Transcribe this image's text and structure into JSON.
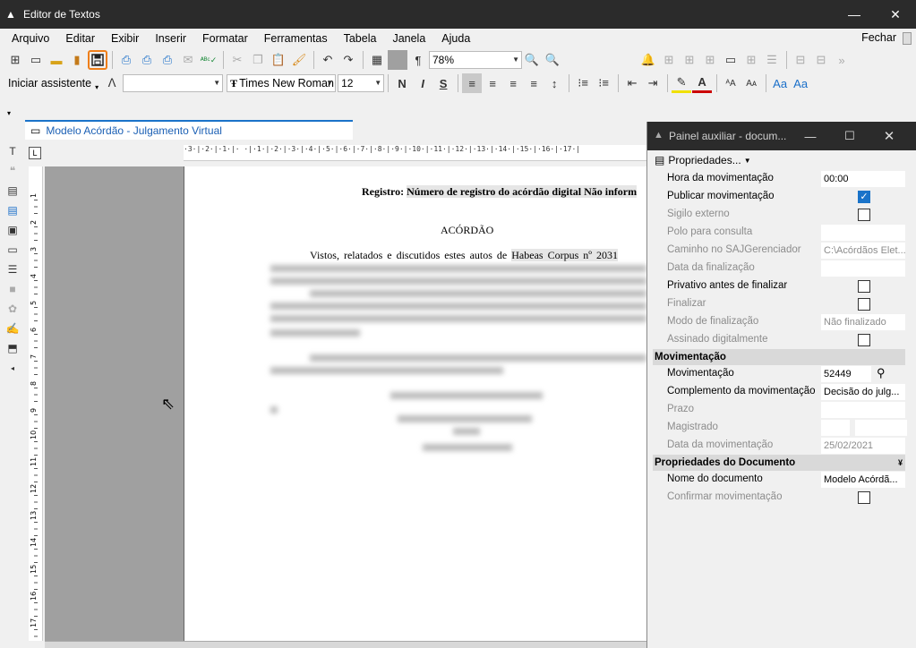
{
  "window": {
    "title": "Editor de Textos",
    "minimize": "—",
    "close": "✕"
  },
  "menu": {
    "items": [
      "Arquivo",
      "Editar",
      "Exibir",
      "Inserir",
      "Formatar",
      "Ferramentas",
      "Tabela",
      "Janela",
      "Ajuda"
    ],
    "close_label": "Fechar"
  },
  "toolbar": {
    "zoom": "78%",
    "assistant": "Iniciar assistente",
    "font": "Times New Roman",
    "size": "12"
  },
  "tab": {
    "label": "Modelo Acórdão - Julgamento Virtual"
  },
  "ruler": {
    "h": "·3·|·2·|·1·|· ·|·1·|·2·|·3·|·4·|·5·|·6·|·7·|·8·|·9·|·10·|·11·|·12·|·13·|·14·|·15·|·16·|·17·|",
    "v": [
      "1",
      "2",
      "3",
      "4",
      "5",
      "6",
      "7",
      "8",
      "9",
      "10",
      "11",
      "12",
      "13",
      "14",
      "15",
      "16",
      "17"
    ]
  },
  "document": {
    "registro_label": "Registro:",
    "registro_value": "Número de registro do acórdão digital Não inform",
    "heading": "ACÓRDÃO",
    "vistos": "Vistos, relatados e discutidos estes autos de",
    "habeas": "Habeas Corpus nº 2031"
  },
  "aux": {
    "title": "Painel auxiliar - docum...",
    "properties_label": "Propriedades...",
    "rows": [
      {
        "label": "Hora da movimentação",
        "value": "00:00"
      },
      {
        "label": "Publicar movimentação"
      },
      {
        "label": "Sigilo externo"
      },
      {
        "label": "Polo para consulta"
      },
      {
        "label": "Caminho no SAJGerenciador",
        "value": "C:\\Acórdãos Elet..."
      },
      {
        "label": "Data da finalização"
      },
      {
        "label": "Privativo antes de finalizar"
      },
      {
        "label": "Finalizar"
      },
      {
        "label": "Modo de finalização",
        "value": "Não finalizado"
      },
      {
        "label": "Assinado digitalmente"
      }
    ],
    "section_mov": "Movimentação",
    "mov_rows": [
      {
        "label": "Movimentação",
        "value": "52449"
      },
      {
        "label": "Complemento da movimentação",
        "value": "Decisão do julg..."
      },
      {
        "label": "Prazo"
      },
      {
        "label": "Magistrado"
      },
      {
        "label": "Data da movimentação",
        "value": "25/02/2021"
      }
    ],
    "section_doc": "Propriedades do Documento",
    "doc_rows": [
      {
        "label": "Nome do documento",
        "value": "Modelo Acórdã..."
      },
      {
        "label": "Confirmar movimentação"
      }
    ]
  }
}
